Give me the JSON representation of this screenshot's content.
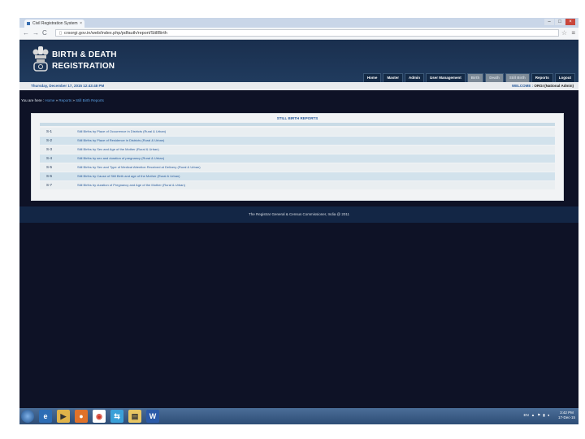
{
  "browser": {
    "tab_title": "Civil Registration System",
    "tab_close": "×",
    "url": "crsorgi.gov.in/web/index.php/pdfauth/report/StillBirth",
    "back": "←",
    "forward": "→",
    "reload": "C",
    "star": "☆",
    "wrench": "≡",
    "win_min": "–",
    "win_max": "□",
    "win_close": "×"
  },
  "site": {
    "brand_line1": "BIRTH & DEATH",
    "brand_line2": "REGISTRATION",
    "menu": [
      "Home",
      "Master",
      "Admin",
      "User Management",
      "Birth",
      "Death",
      "Still Birth",
      "Reports",
      "Logout"
    ],
    "date_line": "Thursday, December 17, 2015 12:43:48 PM",
    "welcome_label": "WELCOME :",
    "welcome_user": "ORGI (National Admin)"
  },
  "breadcrumb": {
    "prefix": "You are here : ",
    "home": "Home",
    "sep": " » ",
    "reports": "Reports",
    "current": "Still Birth Reports"
  },
  "report": {
    "title": "STILL BIRTH REPORTS",
    "rows": [
      {
        "code": "S-1",
        "label": "Still Births by Place of Occurrence in Districts (Rural & Urban)"
      },
      {
        "code": "S-2",
        "label": "Still Births by Place of Residence in Districts (Rural & Urban)"
      },
      {
        "code": "S-3",
        "label": "Still Births by Sex and Age of the Mother (Rural & Urban)"
      },
      {
        "code": "S-4",
        "label": "Still Births by sex and duration of pregnancy (Rural & Urban)"
      },
      {
        "code": "S-5",
        "label": "Still Births by Sex and Type of Medical Attention Received at Delivery (Rural & Urban)"
      },
      {
        "code": "S-6",
        "label": "Still Births by Cause of Still Birth and age of the Mother (Rural & Urban)"
      },
      {
        "code": "S-7",
        "label": "Still Births by duration of Pregnancy and Age of the Mother (Rural & Urban)"
      }
    ]
  },
  "footer": "The Registrar General & Census Commissioner, India @ 2011",
  "taskbar": {
    "icons": [
      "ie-icon",
      "media-player-icon",
      "firefox-icon",
      "chrome-icon",
      "network-icon",
      "explorer-icon",
      "word-icon"
    ],
    "tray_lang": "EN",
    "clock_time": "3:42 PM",
    "clock_date": "17-Dec-15"
  },
  "colors": {
    "page_bg": "#0e1226",
    "header_bg": "#1a2f4e",
    "accent": "#2a5c9c"
  }
}
